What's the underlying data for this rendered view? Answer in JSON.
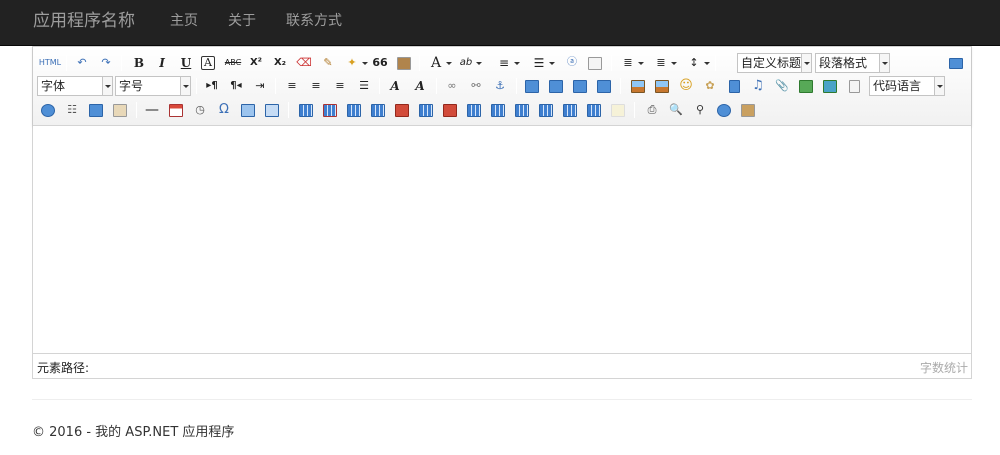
{
  "navbar": {
    "brand": "应用程序名称",
    "links": [
      {
        "label": "主页"
      },
      {
        "label": "关于"
      },
      {
        "label": "联系方式"
      }
    ]
  },
  "editor": {
    "toolbar": {
      "html_label": "HTML",
      "bold": "B",
      "italic": "I",
      "underline": "U",
      "fontborder": "A",
      "strike": "ABC",
      "superscript": "X²",
      "subscript": "X₂",
      "blockquote": "66",
      "forecolor": "A",
      "backcolor": "ab",
      "dir_ltr": "▸¶",
      "dir_rtl": "¶◂",
      "omega": "Ω",
      "custom_heading": "自定义标题",
      "paragraph": "段落格式",
      "font_family": "字体",
      "font_size": "字号",
      "code_language": "代码语言"
    },
    "statusbar": {
      "path_label": "元素路径:",
      "word_count": "字数统计"
    }
  },
  "footer": {
    "text": "© 2016 - 我的 ASP.NET 应用程序"
  },
  "colors": {
    "navbar_bg": "#222222",
    "nav_text": "#9d9d9d",
    "toolbar_bg": "#f1f1f1",
    "border": "#d4d4d4"
  }
}
